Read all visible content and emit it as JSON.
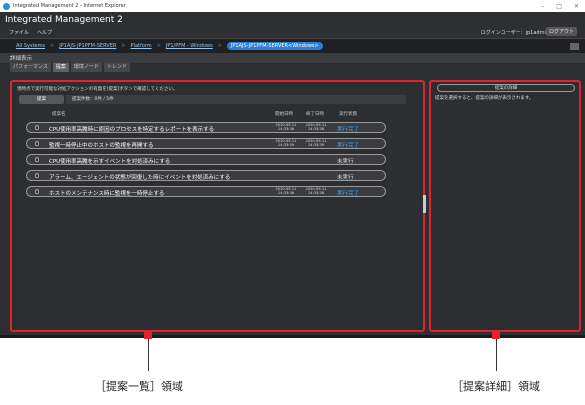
{
  "browser": {
    "title": "Integrated Management 2 - Internet Explorer"
  },
  "app": {
    "title": "Integrated Management 2",
    "menus": [
      "ファイル",
      "ヘルプ"
    ],
    "user": "ログインユーザー：jp1admin",
    "logout": "ログアウト"
  },
  "breadcrumb": {
    "items": [
      "All Systems",
      "JP1AJS-JP1PFM-SERVER",
      "Platform",
      "JP1/PFM - Windows"
    ],
    "current": "JP1AJS-JP1PFM-SERVER<Windows>"
  },
  "detail": {
    "header": "詳細表示"
  },
  "tabs": [
    "パフォーマンス",
    "提案",
    "環境ノード",
    "トレンド"
  ],
  "proposal_list": {
    "description": "現時点で実行可能な対処アクションの有無を[提案]ボタンで確認してください。",
    "search_button": "提案",
    "count": "提案件数：0件 / 5件",
    "columns": {
      "name": "提案名",
      "start": "開始日時",
      "end": "終了日時",
      "status": "実行状態"
    },
    "rows": [
      {
        "title": "CPU使用率高騰時に原因のプロセスを特定するレポートを表示する",
        "start": "2020-09-11 14:33:36",
        "end": "2020-09-11 14:33:38",
        "status": "実行完了",
        "status_kind": "done"
      },
      {
        "title": "監視一時停止中のホストの監視を再開する",
        "start": "2020-09-11 14:33:39",
        "end": "2020-09-11 14:33:39",
        "status": "実行完了",
        "status_kind": "done"
      },
      {
        "title": "CPU使用率高騰を示すイベントを対処済みにする",
        "start": "",
        "end": "",
        "status": "未実行",
        "status_kind": "notyet"
      },
      {
        "title": "アラーム、エージェントの状態が回復した時にイベントを対処済みにする",
        "start": "",
        "end": "",
        "status": "未実行",
        "status_kind": "notyet"
      },
      {
        "title": "ホストのメンテナンス時に監視を一時停止する",
        "start": "2020-09-11 14:33:36",
        "end": "2020-09-11 14:33:38",
        "status": "実行完了",
        "status_kind": "done"
      }
    ]
  },
  "proposal_detail": {
    "title": "提案の詳細",
    "description": "提案を選択すると、提案の詳細が表示されます。"
  },
  "captions": {
    "left": "［提案一覧］領域",
    "right": "［提案詳細］領域"
  }
}
